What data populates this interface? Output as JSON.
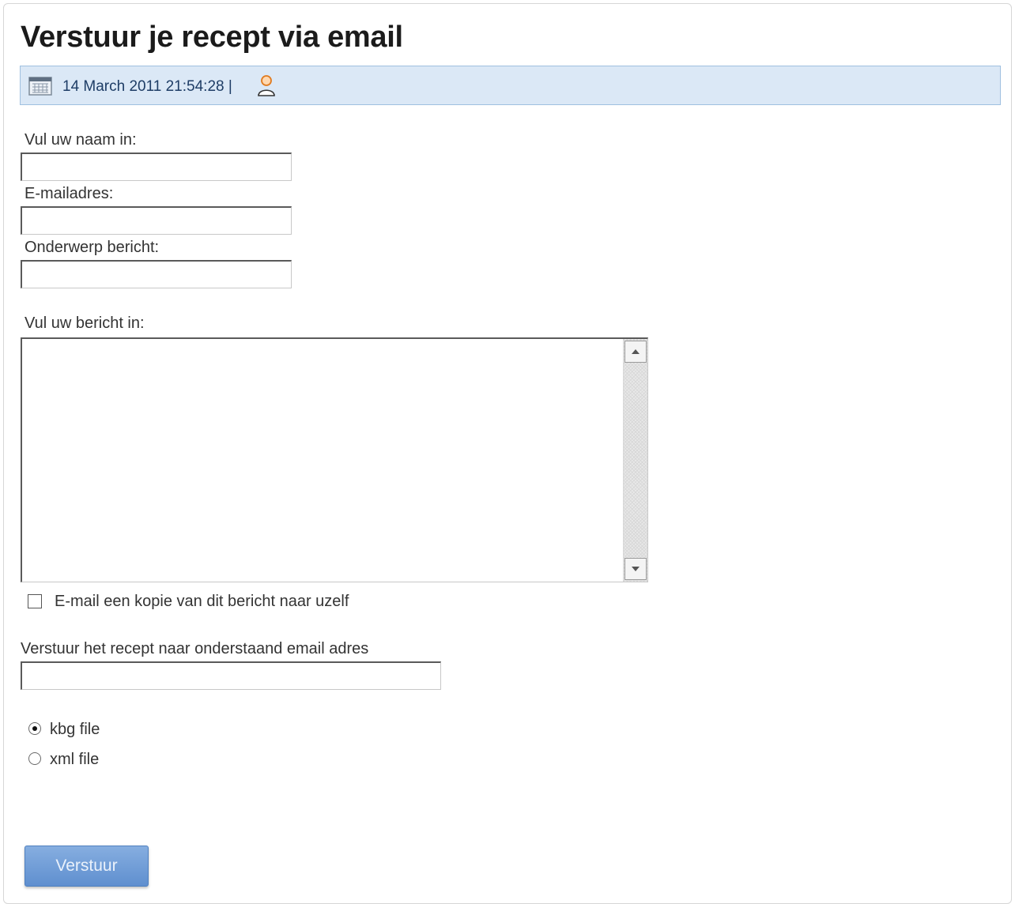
{
  "page": {
    "title": "Verstuur je recept via email"
  },
  "meta": {
    "date": "14 March 2011 21:54:28 |",
    "calendar_icon": "calendar-icon",
    "user_icon": "user-icon"
  },
  "form": {
    "name_label": "Vul uw naam in:",
    "name_value": "",
    "email_label": "E-mailadres:",
    "email_value": "",
    "subject_label": "Onderwerp bericht:",
    "subject_value": "",
    "message_label": "Vul uw bericht in:",
    "message_value": "",
    "copy_checkbox_label": "E-mail een kopie van dit bericht naar uzelf",
    "copy_checked": false,
    "recipient_label": "Verstuur het recept naar onderstaand email adres",
    "recipient_value": "",
    "file_options": [
      {
        "label": "kbg file",
        "selected": true
      },
      {
        "label": "xml file",
        "selected": false
      }
    ],
    "submit_label": "Verstuur"
  },
  "colors": {
    "meta_bar_bg": "#dbe8f6",
    "meta_bar_border": "#9fc0e0",
    "button_bg": "#6f9ad6",
    "date_text": "#1e3d66"
  }
}
